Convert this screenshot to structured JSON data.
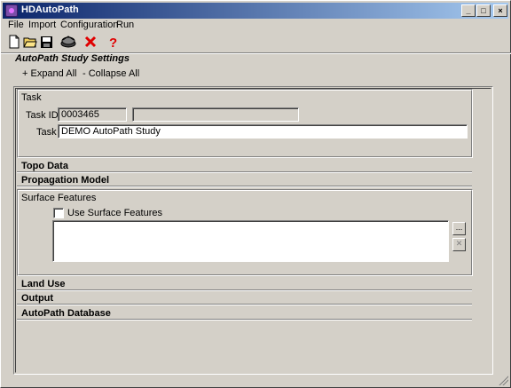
{
  "window": {
    "title": "HDAutoPath",
    "minimize_glyph": "_",
    "maximize_glyph": "□",
    "close_glyph": "×"
  },
  "menu": {
    "items": [
      "File",
      "Import",
      "Configuration",
      "Run"
    ]
  },
  "toolbar": {
    "buttons": [
      {
        "icon": "new-document-icon"
      },
      {
        "icon": "open-folder-icon"
      },
      {
        "icon": "save-disk-icon"
      },
      {
        "icon": "run-study-icon"
      },
      {
        "icon": "delete-x-icon",
        "color": "#e00000"
      },
      {
        "icon": "help-question-icon",
        "color": "#e00000"
      }
    ]
  },
  "settings": {
    "title": "AutoPath Study Settings",
    "expand_all": "+ Expand All",
    "collapse_all": "- Collapse All"
  },
  "task": {
    "group_label": "Task",
    "task_id_label": "Task ID:",
    "task_id_value": "0003465",
    "task_id_secondary_value": "",
    "task_label": "Task",
    "task_value": "DEMO AutoPath Study"
  },
  "sections": {
    "topo_data": "Topo Data",
    "propagation_model": "Propagation Model",
    "land_use": "Land Use",
    "output": "Output",
    "autopath_database": "AutoPath Database"
  },
  "surface_features": {
    "group_label": "Surface Features",
    "checkbox_label": "Use Surface Features",
    "checked": false,
    "browse_label": "...",
    "remove_label": "✕"
  }
}
